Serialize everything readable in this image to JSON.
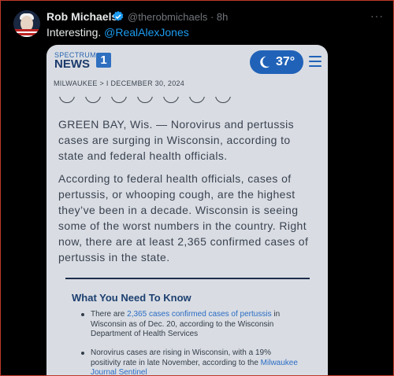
{
  "tweet": {
    "name": "Rob Michaels",
    "handle": "@therobmichaels · 8h",
    "more": "···",
    "text_prefix": "Interesting. ",
    "mention": "@RealAlexJones"
  },
  "article": {
    "logo_top": "SPECTRUM",
    "logo_news": "NEWS",
    "logo_num": "1",
    "temperature": "37°",
    "breadcrumb": "MILWAUKEE  >  I  DECEMBER 30, 2024",
    "paragraph1": "GREEN BAY, Wis. — Norovirus and pertussis cases are surging in Wisconsin, according to state and federal health officials.",
    "paragraph2": "According to federal health officials, cases of pertussis, or whooping cough, are the highest they’ve been in a decade. Wisconsin is seeing some of the worst numbers in the country. Right now, there are at least 2,365 confirmed cases of pertussis in the state.",
    "section_title": "What You Need To Know",
    "bullet1_pre": "There are ",
    "bullet1_link": "2,365 cases confirmed cases of pertussis",
    "bullet1_post": " in Wisconsin as of Dec. 20, according to the Wisconsin Department of Health Services",
    "bullet2_pre": "Norovirus cases are rising in Wisconsin, with a 19% positivity rate in late November, according to the ",
    "bullet2_link": "Milwaukee Journal Sentinel"
  },
  "colors": {
    "accent": "#1d9bf0",
    "brand": "#2062b8"
  }
}
